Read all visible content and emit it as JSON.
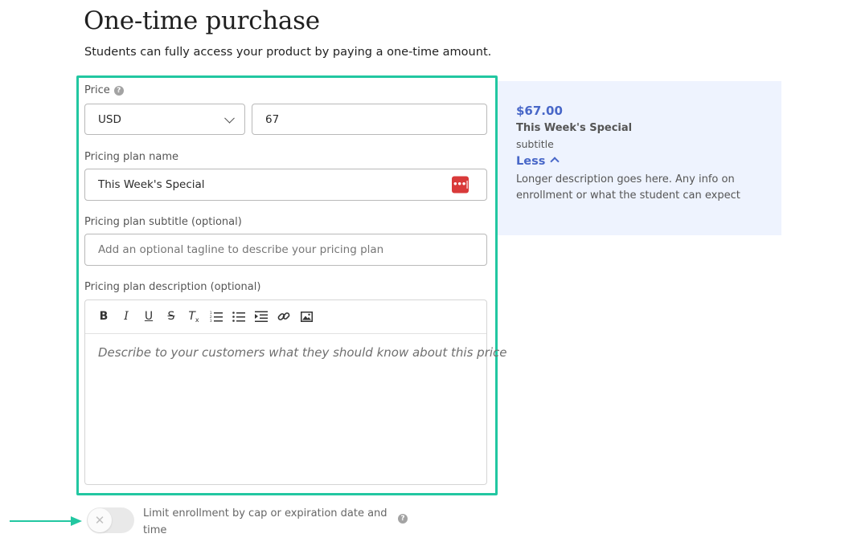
{
  "header": {
    "title": "One-time purchase",
    "subtitle": "Students can fully access your product by paying a one-time amount."
  },
  "form": {
    "price_label": "Price",
    "currency": {
      "value": "USD"
    },
    "amount": {
      "value": "67"
    },
    "plan_name_label": "Pricing plan name",
    "plan_name": {
      "value": "This Week's Special",
      "password_manager_icon": "•••|"
    },
    "plan_subtitle_label": "Pricing plan subtitle (optional)",
    "plan_subtitle": {
      "value": "",
      "placeholder": "Add an optional tagline to describe your pricing plan"
    },
    "plan_description_label": "Pricing plan description (optional)",
    "plan_description": {
      "value": "",
      "placeholder": "Describe to your customers what they should know about this price"
    },
    "toolbar": [
      "bold-icon",
      "italic-icon",
      "underline-icon",
      "strikethrough-icon",
      "clear-format-icon",
      "ordered-list-icon",
      "bullet-list-icon",
      "indent-icon",
      "link-icon",
      "image-icon"
    ]
  },
  "preview": {
    "price": "$67.00",
    "name": "This Week's Special",
    "subtitle": "subtitle",
    "toggle_label": "Less",
    "description": "Longer description goes here. Any info on enrollment or what the student can expect"
  },
  "enrollment": {
    "toggle_label": "Limit enrollment by cap or expiration date and time",
    "enabled": false
  },
  "colors": {
    "highlight": "#22c7a1",
    "accent": "#4867c8",
    "preview_bg": "#eef3fe"
  }
}
